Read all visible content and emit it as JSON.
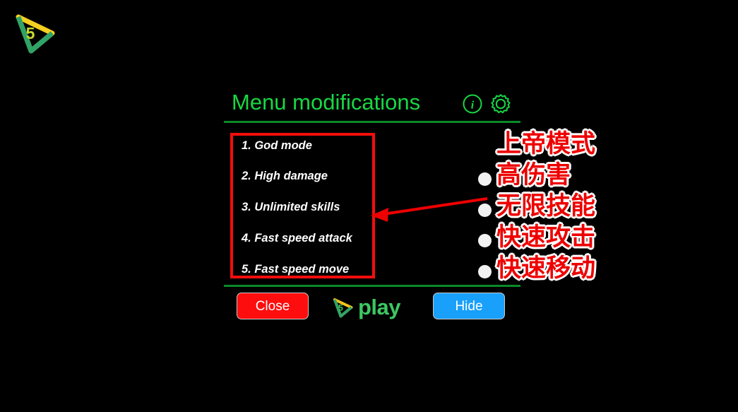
{
  "app": {
    "logo_name": "5play-logo",
    "logo_digit": "5"
  },
  "menu": {
    "title": "Menu modifications",
    "info_icon": "info-circle-icon",
    "gear_icon": "gear-icon",
    "items": [
      {
        "label": "1. God mode",
        "toggle_state": "off"
      },
      {
        "label": "2. High damage",
        "toggle_state": "off"
      },
      {
        "label": "3. Unlimited skills",
        "toggle_state": "off"
      },
      {
        "label": "4. Fast speed attack",
        "toggle_state": "off"
      },
      {
        "label": "5. Fast speed move",
        "toggle_state": "off"
      }
    ],
    "footer": {
      "close_label": "Close",
      "hide_label": "Hide",
      "brand_text": "play",
      "brand_digit": "5"
    }
  },
  "annotations": {
    "highlight_box_color": "#f50d0d",
    "arrow_color": "#ee0000",
    "translations": [
      "上帝模式",
      "高伤害",
      "无限技能",
      "快速攻击",
      "快速移动"
    ]
  },
  "colors": {
    "background": "#000000",
    "title_green": "#18d744",
    "separator_green": "#0a8a2a",
    "close_red": "#fd0d0d",
    "hide_blue": "#18a0fb",
    "brand_green": "#3dc763",
    "toggle_white": "#f2f2f2",
    "annotation_red": "#ee0000"
  }
}
